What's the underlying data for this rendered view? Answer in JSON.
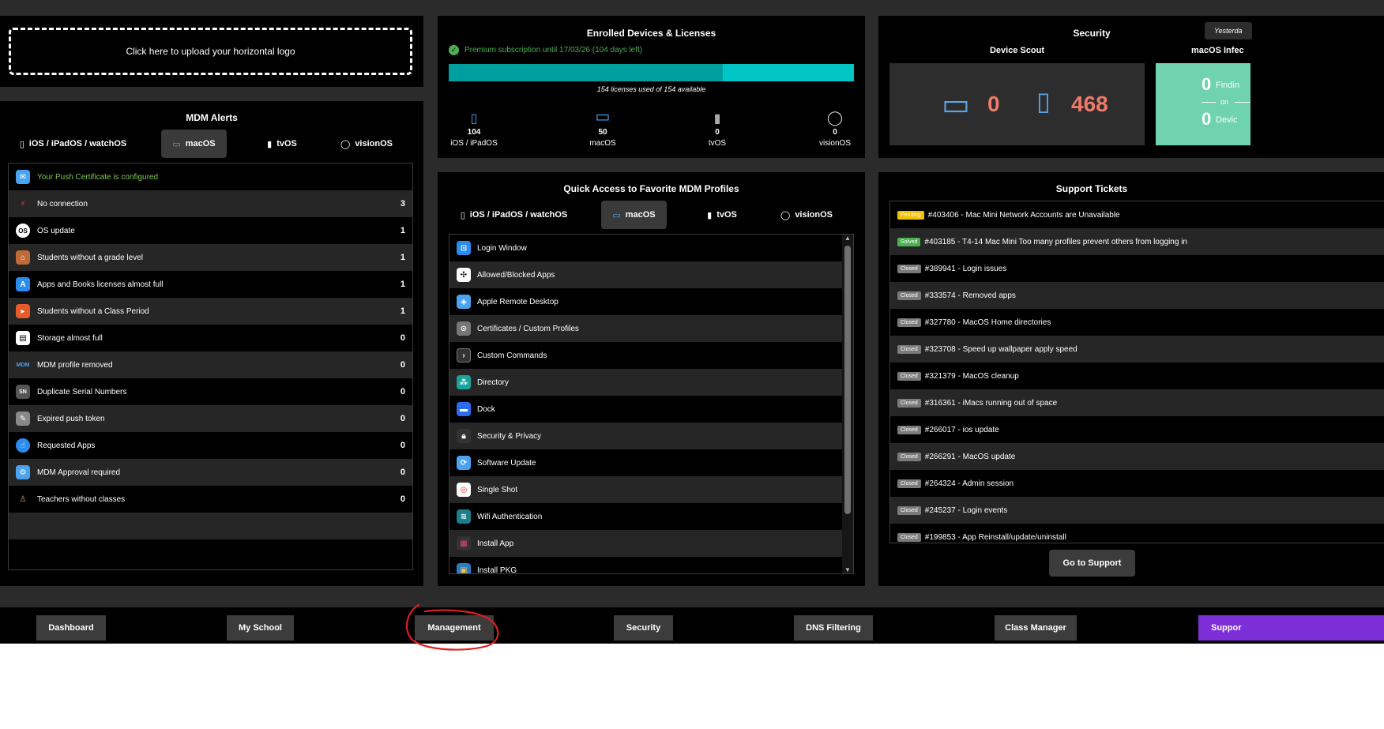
{
  "upload": {
    "label": "Click here to upload your horizontal logo"
  },
  "alerts": {
    "title": "MDM Alerts",
    "tabs": [
      {
        "label": "iOS / iPadOS / watchOS",
        "icon": "ipad-icon",
        "active": false
      },
      {
        "label": "macOS",
        "icon": "macbook-icon",
        "active": true
      },
      {
        "label": "tvOS",
        "icon": "apple-tv-icon",
        "active": false
      },
      {
        "label": "visionOS",
        "icon": "vision-pro-icon",
        "active": false
      }
    ],
    "items": [
      {
        "label": "Your Push Certificate is configured",
        "count": "",
        "icon": "push-certificate-icon",
        "color": "#7bc94a"
      },
      {
        "label": "No connection",
        "count": "3",
        "icon": "no-connection-icon"
      },
      {
        "label": "OS update",
        "count": "1",
        "icon": "os-update-icon"
      },
      {
        "label": "Students without a grade level",
        "count": "1",
        "icon": "school-icon"
      },
      {
        "label": "Apps and Books licenses almost full",
        "count": "1",
        "icon": "app-store-icon"
      },
      {
        "label": "Students without a Class Period",
        "count": "1",
        "icon": "class-period-icon"
      },
      {
        "label": "Storage almost full",
        "count": "0",
        "icon": "storage-icon"
      },
      {
        "label": "MDM profile removed",
        "count": "0",
        "icon": "mdm-removed-icon"
      },
      {
        "label": "Duplicate Serial Numbers",
        "count": "0",
        "icon": "serial-number-icon"
      },
      {
        "label": "Expired push token",
        "count": "0",
        "icon": "expired-token-icon"
      },
      {
        "label": "Requested Apps",
        "count": "0",
        "icon": "requested-apps-icon"
      },
      {
        "label": "MDM Approval required",
        "count": "0",
        "icon": "mdm-approval-icon"
      },
      {
        "label": "Teachers without classes",
        "count": "0",
        "icon": "teacher-icon"
      }
    ]
  },
  "enrolled": {
    "title": "Enrolled Devices & Licenses",
    "premium": "Premium subscription until 17/03/26 (104 days left)",
    "bar_caption": "154 licenses used of 154 available",
    "used_fraction": 0.676,
    "devices": [
      {
        "count": "104",
        "name": "iOS / iPadOS",
        "icon": "ipad-icon"
      },
      {
        "count": "50",
        "name": "macOS",
        "icon": "macbook-icon"
      },
      {
        "count": "0",
        "name": "tvOS",
        "icon": "apple-tv-icon"
      },
      {
        "count": "0",
        "name": "visionOS",
        "icon": "vision-pro-icon"
      }
    ]
  },
  "security": {
    "title": "Security",
    "filter": "Yesterda",
    "device_scout": {
      "label": "Device Scout",
      "mac_count": "0",
      "ipad_count": "468"
    },
    "infected": {
      "label": "macOS Infec",
      "findings": "0",
      "findings_label": "Findin",
      "on_label": "on",
      "devices": "0",
      "devices_label": "Devic"
    }
  },
  "profiles": {
    "title": "Quick Access to Favorite MDM Profiles",
    "tabs": [
      {
        "label": "iOS / iPadOS / watchOS",
        "icon": "ipad-icon",
        "active": false
      },
      {
        "label": "macOS",
        "icon": "macbook-icon",
        "active": true
      },
      {
        "label": "tvOS",
        "icon": "apple-tv-icon",
        "active": false
      },
      {
        "label": "visionOS",
        "icon": "vision-pro-icon",
        "active": false
      }
    ],
    "items": [
      {
        "label": "Login Window",
        "icon": "login-window-icon"
      },
      {
        "label": "Allowed/Blocked Apps",
        "icon": "allowed-apps-icon"
      },
      {
        "label": "Apple Remote Desktop",
        "icon": "remote-desktop-icon"
      },
      {
        "label": "Certificates / Custom Profiles",
        "icon": "certificate-icon"
      },
      {
        "label": "Custom Commands",
        "icon": "terminal-icon"
      },
      {
        "label": "Directory",
        "icon": "directory-icon"
      },
      {
        "label": "Dock",
        "icon": "dock-icon"
      },
      {
        "label": "Security & Privacy",
        "icon": "lock-icon"
      },
      {
        "label": "Software Update",
        "icon": "software-update-icon"
      },
      {
        "label": "Single Shot",
        "icon": "single-shot-icon"
      },
      {
        "label": "Wifi Authentication",
        "icon": "wifi-icon"
      },
      {
        "label": "Install App",
        "icon": "install-app-icon"
      },
      {
        "label": "Install PKG",
        "icon": "package-icon"
      }
    ]
  },
  "tickets": {
    "title": "Support Tickets",
    "items": [
      {
        "status": "Pending",
        "text": "#403406 - Mac Mini Network Accounts are Unavailable"
      },
      {
        "status": "Solved",
        "text": "#403185 - T4-14 Mac Mini Too many profiles prevent others from logging in"
      },
      {
        "status": "Closed",
        "text": "#389941 - Login issues"
      },
      {
        "status": "Closed",
        "text": "#333574 - Removed apps"
      },
      {
        "status": "Closed",
        "text": "#327780 - MacOS Home directories"
      },
      {
        "status": "Closed",
        "text": "#323708 - Speed up wallpaper apply speed"
      },
      {
        "status": "Closed",
        "text": "#321379 - MacOS cleanup"
      },
      {
        "status": "Closed",
        "text": "#316361 - iMacs running out of space"
      },
      {
        "status": "Closed",
        "text": "#266017 - ios update"
      },
      {
        "status": "Closed",
        "text": "#266291 - MacOS update"
      },
      {
        "status": "Closed",
        "text": "#264324 - Admin session"
      },
      {
        "status": "Closed",
        "text": "#245237 - Login events"
      },
      {
        "status": "Closed",
        "text": "#199853 - App Reinstall/update/uninstall"
      }
    ],
    "button": "Go to Support"
  },
  "nav": [
    {
      "label": "Dashboard"
    },
    {
      "label": "My School"
    },
    {
      "label": "Management"
    },
    {
      "label": "Security"
    },
    {
      "label": "DNS Filtering"
    },
    {
      "label": "Class Manager"
    },
    {
      "label": "Suppor"
    }
  ],
  "colors": {
    "accent_teal": "#00c5c5",
    "bar_used": "#009f9f",
    "success": "#4caf50",
    "pending": "#f4c000",
    "scout_number": "#f07a6a",
    "infected_bg": "#6fd3b0",
    "support": "#7c2fd6",
    "annotation": "#e01e1e"
  }
}
